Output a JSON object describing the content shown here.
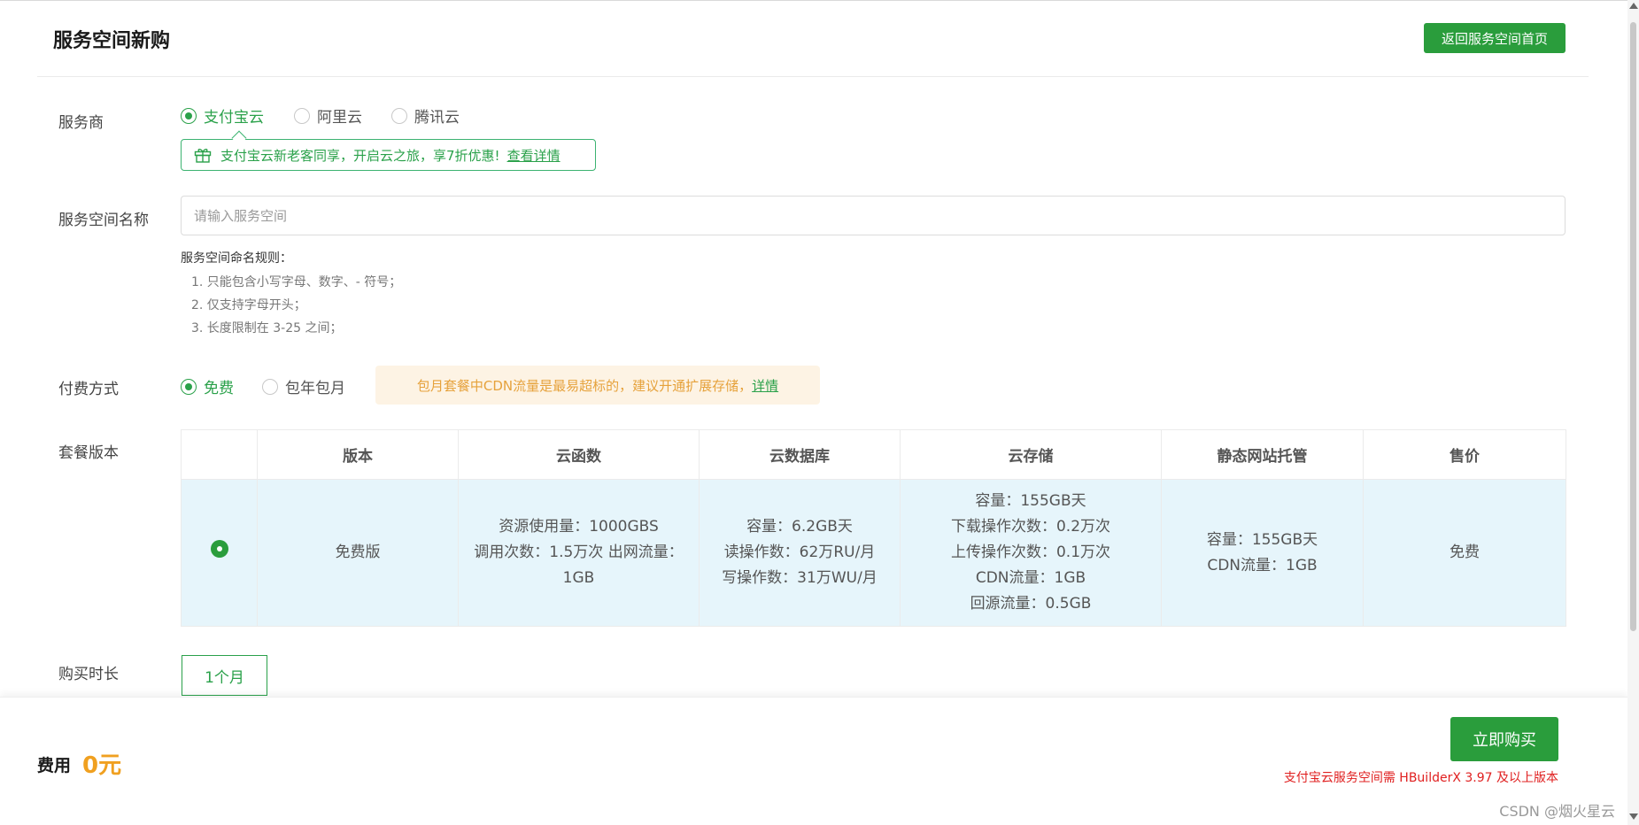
{
  "header": {
    "title": "服务空间新购",
    "back_button": "返回服务空间首页"
  },
  "provider": {
    "label": "服务商",
    "options": [
      "支付宝云",
      "阿里云",
      "腾讯云"
    ],
    "selected": "支付宝云",
    "promo_text": "支付宝云新老客同享，开启云之旅，享7折优惠!",
    "promo_link": "查看详情"
  },
  "space_name": {
    "label": "服务空间名称",
    "placeholder": "请输入服务空间",
    "value": "",
    "rules_title": "服务空间命名规则：",
    "rules": [
      "1. 只能包含小写字母、数字、- 符号；",
      "2. 仅支持字母开头；",
      "3. 长度限制在 3-25 之间；"
    ]
  },
  "payment": {
    "label": "付费方式",
    "options": [
      "免费",
      "包年包月"
    ],
    "selected": "免费",
    "note_text": "包月套餐中CDN流量是最易超标的，建议开通扩展存储，",
    "note_link": "详情"
  },
  "plan": {
    "label": "套餐版本",
    "headers": [
      "",
      "版本",
      "云函数",
      "云数据库",
      "云存储",
      "静态网站托管",
      "售价"
    ],
    "row": {
      "version": "免费版",
      "cloud_function": [
        "资源使用量：1000GBS",
        "调用次数：1.5万次 出网流量：",
        "1GB"
      ],
      "cloud_db": [
        "容量：6.2GB天",
        "读操作数：62万RU/月",
        "写操作数：31万WU/月"
      ],
      "cloud_storage": [
        "容量：155GB天",
        "下载操作次数：0.2万次",
        "上传操作次数：0.1万次",
        "CDN流量：1GB",
        "回源流量：0.5GB"
      ],
      "static_hosting": [
        "容量：155GB天",
        "CDN流量：1GB"
      ],
      "price": "免费"
    }
  },
  "duration": {
    "label": "购买时长",
    "option": "1个月"
  },
  "footer": {
    "fee_label": "费用",
    "fee_value": "0元",
    "buy_button": "立即购买",
    "version_note": "支付宝云服务空间需 HBuilderX 3.97 及以上版本",
    "watermark": "CSDN @烟火星云"
  },
  "colors": {
    "primary": "#2a9d3c",
    "accent_text": "#2aa14a",
    "warning": "#e6a23c",
    "fee": "#f0a020",
    "error": "#e02020",
    "row_bg": "#e6f5fb"
  },
  "icons": [
    "gift-icon",
    "radio-checked-icon",
    "scroll-up-icon",
    "scroll-down-icon"
  ]
}
